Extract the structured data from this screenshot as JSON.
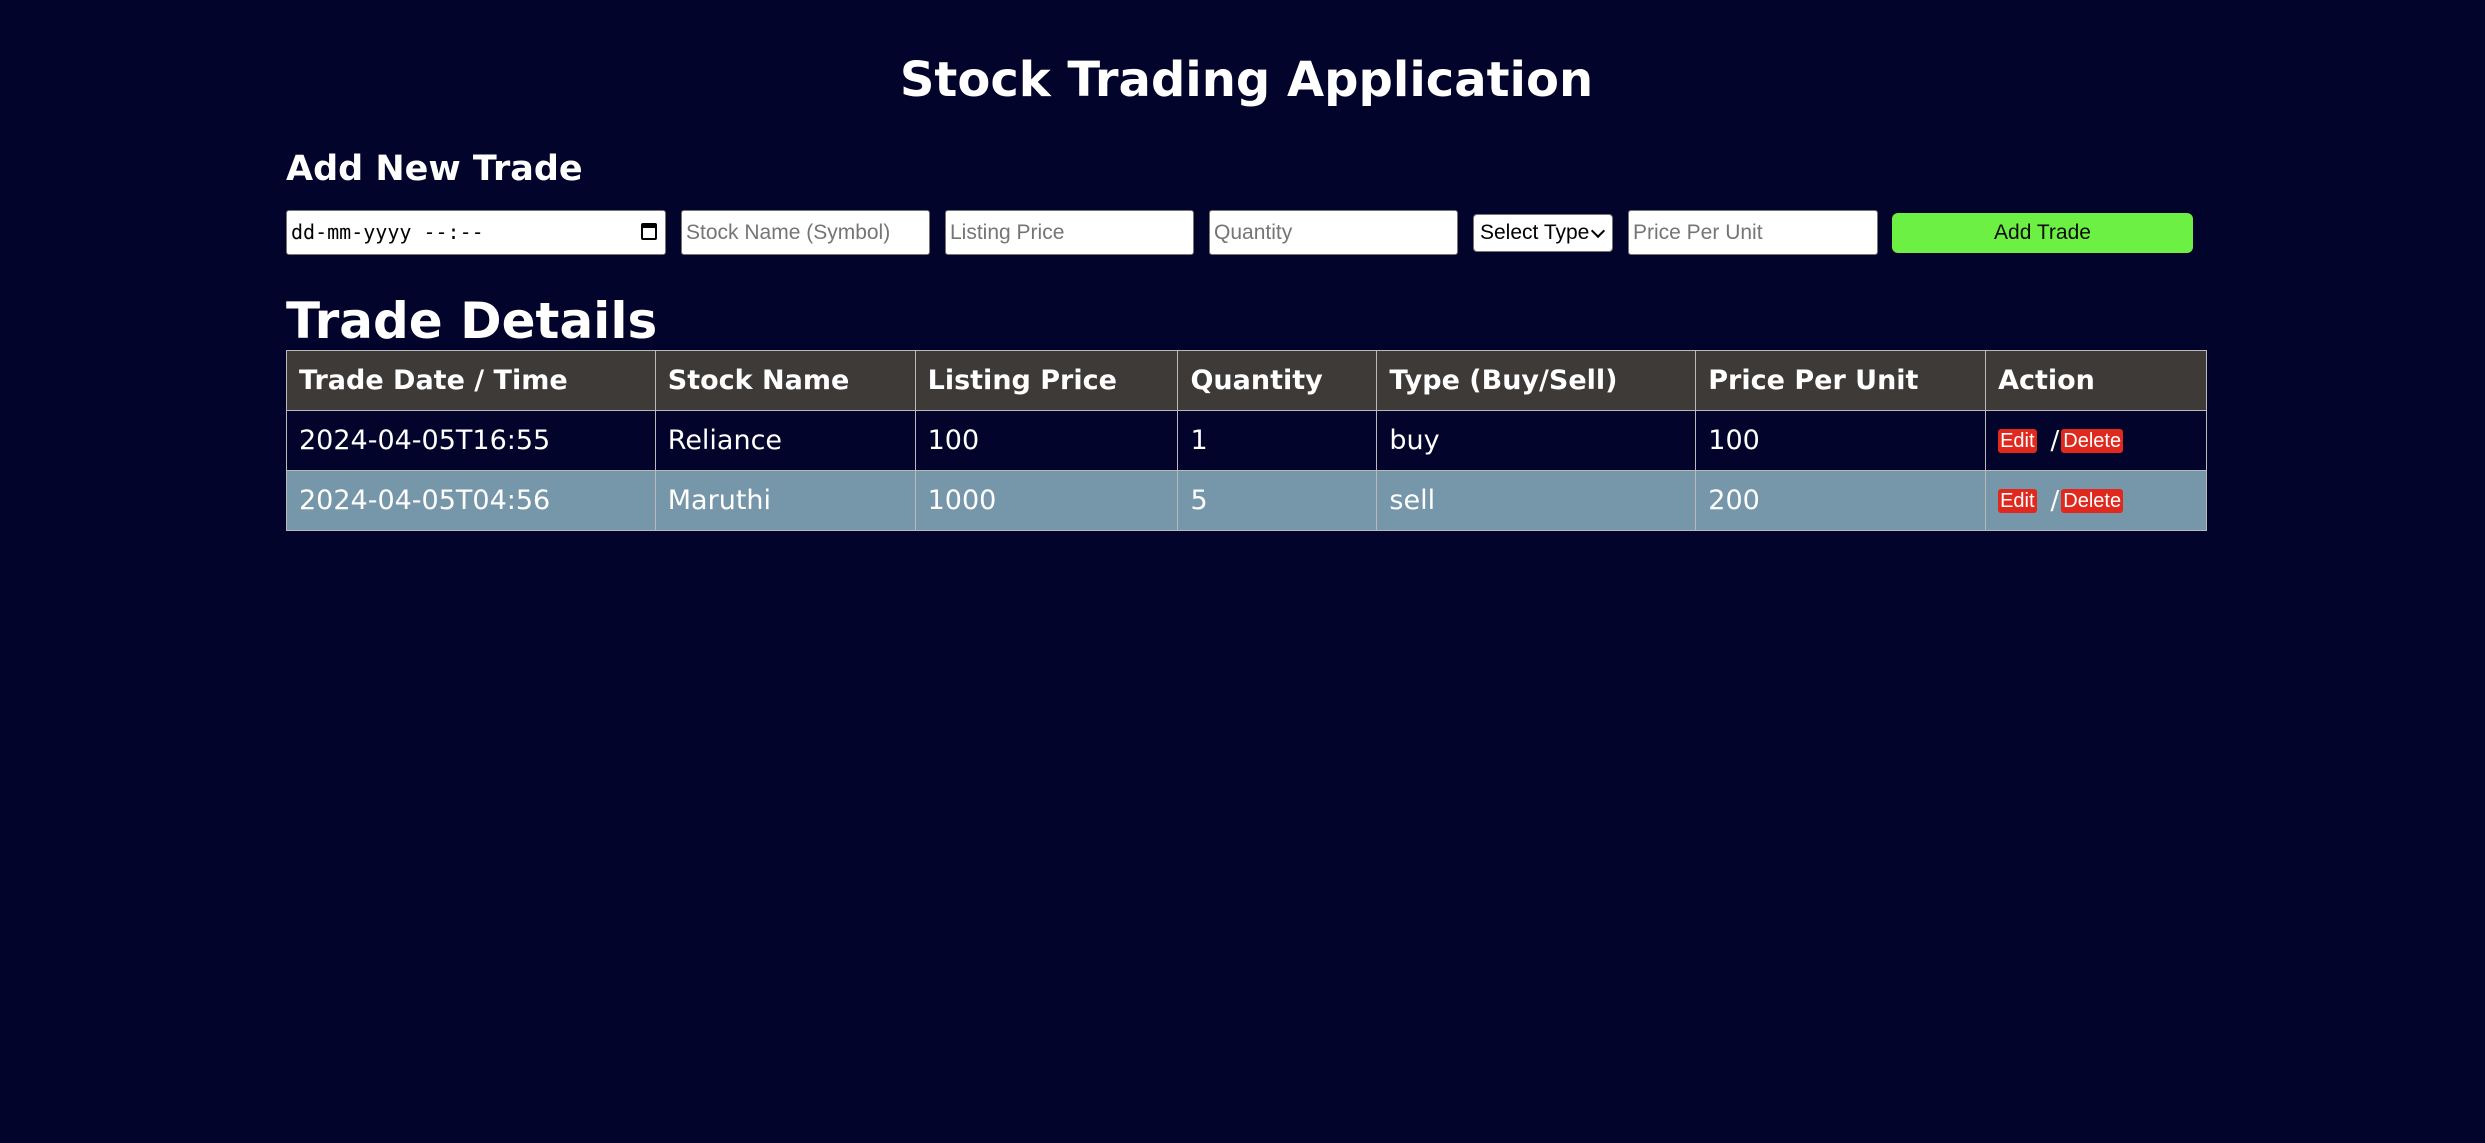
{
  "app": {
    "title": "Stock Trading Application"
  },
  "add_form": {
    "heading": "Add New Trade",
    "datetime_placeholder": "dd-mm-yyyy --:--",
    "stock_name_placeholder": "Stock Name (Symbol)",
    "listing_price_placeholder": "Listing Price",
    "quantity_placeholder": "Quantity",
    "type_select_value": "Select Type",
    "price_per_unit_placeholder": "Price Per Unit",
    "submit_label": "Add Trade"
  },
  "trades": {
    "heading": "Trade Details",
    "columns": [
      "Trade Date / Time",
      "Stock Name",
      "Listing Price",
      "Quantity",
      "Type (Buy/Sell)",
      "Price Per Unit",
      "Action"
    ],
    "rows": [
      {
        "datetime": "2024-04-05T16:55",
        "stock": "Reliance",
        "listing_price": "100",
        "quantity": "1",
        "type": "buy",
        "price_per_unit": "100",
        "edit_label": "Edit",
        "separator": "/",
        "delete_label": "Delete"
      },
      {
        "datetime": "2024-04-05T04:56",
        "stock": "Maruthi",
        "listing_price": "1000",
        "quantity": "5",
        "type": "sell",
        "price_per_unit": "200",
        "edit_label": "Edit",
        "separator": "/",
        "delete_label": "Delete"
      }
    ]
  },
  "colors": {
    "background": "#03042b",
    "header_row": "#3d3a38",
    "alt_row": "#7697aa",
    "add_button": "#6cf044",
    "action_button": "#e0281e"
  },
  "icons": {
    "datetime_picker": "calendar-icon",
    "select_dropdown": "chevron-down-icon"
  }
}
